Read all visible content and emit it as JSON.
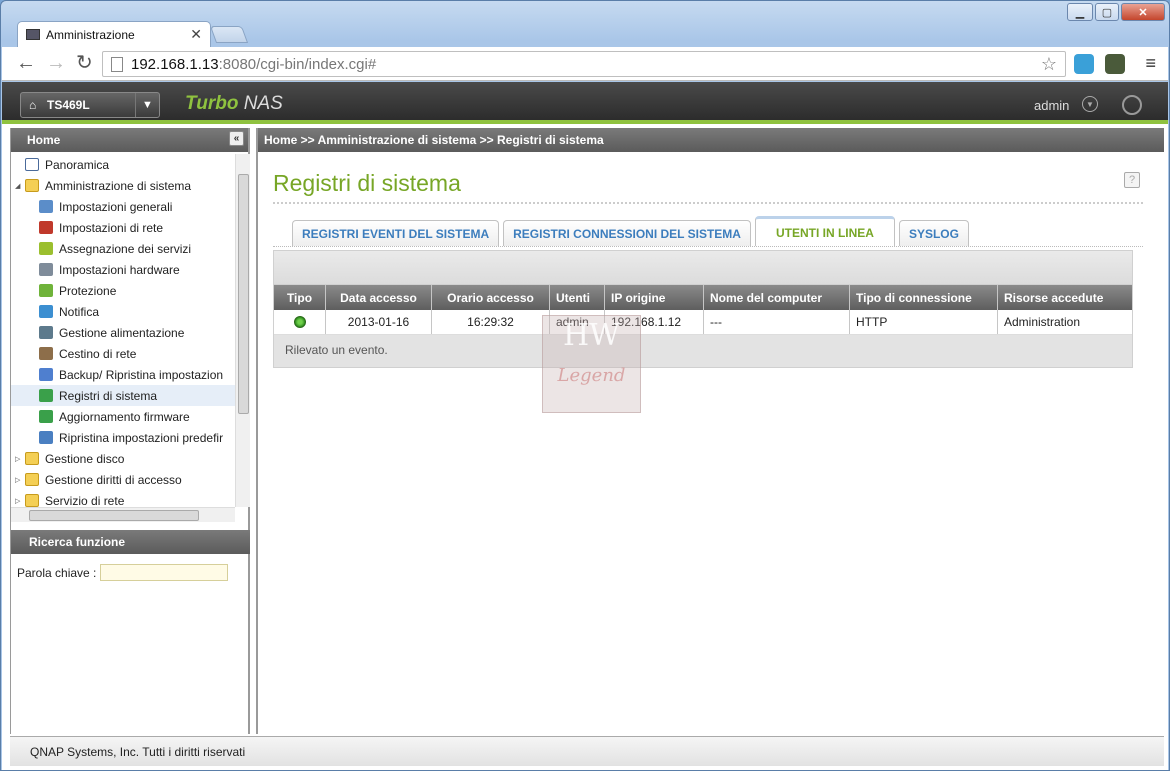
{
  "browser": {
    "tab_title": "Amministrazione",
    "url_host": "192.168.1.13",
    "url_rest": ":8080/cgi-bin/index.cgi#"
  },
  "header": {
    "device": "TS469L",
    "brand_turbo": "Turbo",
    "brand_nas": "NAS",
    "user": "admin"
  },
  "sidebar": {
    "title": "Home",
    "items": [
      {
        "label": "Panoramica",
        "level": 0,
        "icon": "overview-icon"
      },
      {
        "label": "Amministrazione di sistema",
        "level": 0,
        "icon": "folder-open-icon",
        "expanded": true
      },
      {
        "label": "Impostazioni generali",
        "level": 1,
        "icon": "settings-icon"
      },
      {
        "label": "Impostazioni di rete",
        "level": 1,
        "icon": "network-icon"
      },
      {
        "label": "Assegnazione dei servizi",
        "level": 1,
        "icon": "services-icon"
      },
      {
        "label": "Impostazioni hardware",
        "level": 1,
        "icon": "hardware-icon"
      },
      {
        "label": "Protezione",
        "level": 1,
        "icon": "security-icon"
      },
      {
        "label": "Notifica",
        "level": 1,
        "icon": "notification-icon"
      },
      {
        "label": "Gestione alimentazione",
        "level": 1,
        "icon": "power-icon"
      },
      {
        "label": "Cestino di rete",
        "level": 1,
        "icon": "recycle-bin-icon"
      },
      {
        "label": "Backup/ Ripristina impostazion",
        "level": 1,
        "icon": "backup-icon"
      },
      {
        "label": "Registri di sistema",
        "level": 1,
        "icon": "logs-icon",
        "selected": true
      },
      {
        "label": "Aggiornamento firmware",
        "level": 1,
        "icon": "firmware-icon"
      },
      {
        "label": "Ripristina impostazioni predefir",
        "level": 1,
        "icon": "restore-icon"
      },
      {
        "label": "Gestione disco",
        "level": 0,
        "icon": "folder-icon"
      },
      {
        "label": "Gestione diritti di accesso",
        "level": 0,
        "icon": "folder-icon"
      },
      {
        "label": "Servizio di rete",
        "level": 0,
        "icon": "folder-icon"
      }
    ]
  },
  "search": {
    "title": "Ricerca funzione",
    "label": "Parola chiave :",
    "value": ""
  },
  "main": {
    "breadcrumb": "Home >> Amministrazione di sistema >> Registri di sistema",
    "title": "Registri di sistema",
    "tabs": [
      {
        "label": "REGISTRI EVENTI DEL SISTEMA",
        "active": false
      },
      {
        "label": "REGISTRI CONNESSIONI DEL SISTEMA",
        "active": false
      },
      {
        "label": "UTENTI IN LINEA",
        "active": true
      },
      {
        "label": "SYSLOG",
        "active": false
      }
    ],
    "columns": [
      "Tipo",
      "Data accesso",
      "Orario accesso",
      "Utenti",
      "IP origine",
      "Nome del computer",
      "Tipo di connessione",
      "Risorse accedute"
    ],
    "rows": [
      {
        "type_icon": "online-status-icon",
        "date": "2013-01-16",
        "time": "16:29:32",
        "user": "admin",
        "ip": "192.168.1.12",
        "computer": "---",
        "conn_type": "HTTP",
        "resources": "Administration"
      }
    ],
    "status": "Rilevato un evento."
  },
  "watermark": {
    "top": "HW",
    "bottom": "Legend"
  },
  "footer": "QNAP Systems, Inc. Tutti i diritti riservati"
}
